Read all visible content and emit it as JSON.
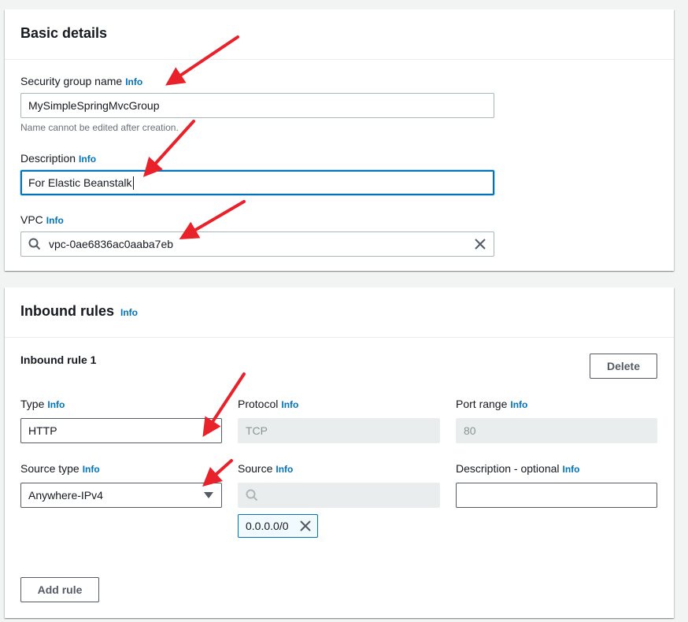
{
  "basic_details": {
    "title": "Basic details",
    "name_label": "Security group name",
    "name_info": "Info",
    "name_value": "MySimpleSpringMvcGroup",
    "name_hint": "Name cannot be edited after creation.",
    "description_label": "Description",
    "description_info": "Info",
    "description_value": "For Elastic Beanstalk",
    "vpc_label": "VPC",
    "vpc_info": "Info",
    "vpc_value": "vpc-0ae6836ac0aaba7eb"
  },
  "inbound_rules": {
    "title": "Inbound rules",
    "title_info": "Info",
    "rule_title": "Inbound rule 1",
    "delete_label": "Delete",
    "type_label": "Type",
    "type_info": "Info",
    "type_value": "HTTP",
    "protocol_label": "Protocol",
    "protocol_info": "Info",
    "protocol_value": "TCP",
    "port_label": "Port range",
    "port_info": "Info",
    "port_value": "80",
    "source_type_label": "Source type",
    "source_type_info": "Info",
    "source_type_value": "Anywhere-IPv4",
    "source_label": "Source",
    "source_info": "Info",
    "source_token": "0.0.0.0/0",
    "desc_label": "Description - optional",
    "desc_info": "Info",
    "add_rule_label": "Add rule"
  },
  "colors": {
    "link": "#0073bb",
    "annotation_arrow": "#e8212b",
    "focus": "#0073bb"
  },
  "icons": [
    "search-icon",
    "clear-icon",
    "caret-down-icon",
    "remove-token-icon"
  ]
}
